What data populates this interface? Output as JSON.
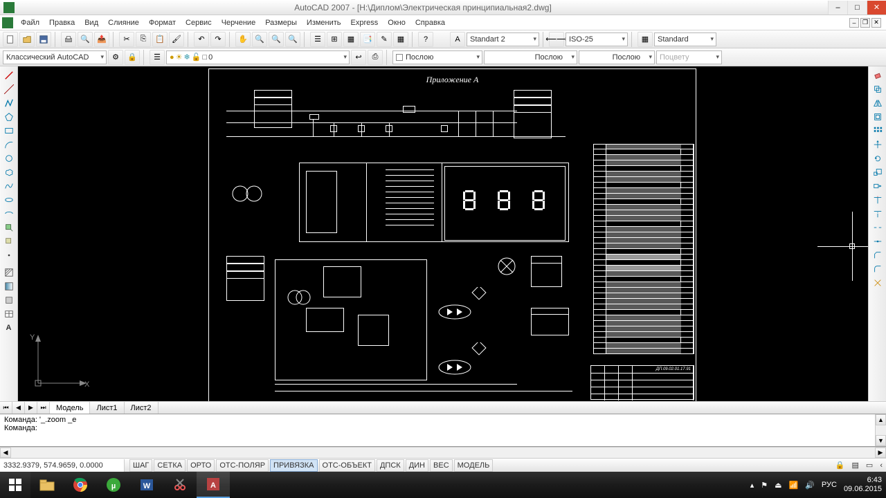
{
  "window": {
    "title": "AutoCAD 2007 - [Н:\\Диплом\\Электрическая принципиальная2.dwg]"
  },
  "menu": {
    "items": [
      "Файл",
      "Правка",
      "Вид",
      "Слияние",
      "Формат",
      "Сервис",
      "Черчение",
      "Размеры",
      "Изменить",
      "Express",
      "Окно",
      "Справка"
    ]
  },
  "toolbar1": {
    "text_style": "Standart 2",
    "dim_style": "ISO-25",
    "table_style": "Standard"
  },
  "toolbar2": {
    "workspace": "Классический AutoCAD",
    "layer": "0",
    "linetype": "Послою",
    "lineweight": "Послою",
    "lineweight2": "Послою",
    "plotstyle": "Поцвету"
  },
  "drawing": {
    "title": "Приложение А",
    "titleblock_code": "ДП.09.02.01.17.91"
  },
  "tabs": {
    "items": [
      "Модель",
      "Лист1",
      "Лист2"
    ],
    "active": 0
  },
  "command": {
    "line1": "Команда: '_.zoom _e",
    "line2": "Команда:"
  },
  "status": {
    "coords": "3332.9379, 574.9659, 0.0000",
    "toggles": [
      "ШАГ",
      "СЕТКА",
      "ОРТО",
      "ОТС-ПОЛЯР",
      "ПРИВЯЗКА",
      "ОТС-ОБЪЕКТ",
      "ДПСК",
      "ДИН",
      "ВЕС",
      "МОДЕЛЬ"
    ],
    "toggle_states": [
      false,
      false,
      false,
      false,
      true,
      false,
      false,
      false,
      false,
      false
    ]
  },
  "tray": {
    "lang": "РУС",
    "time": "6:43",
    "date": "09.06.2015"
  }
}
